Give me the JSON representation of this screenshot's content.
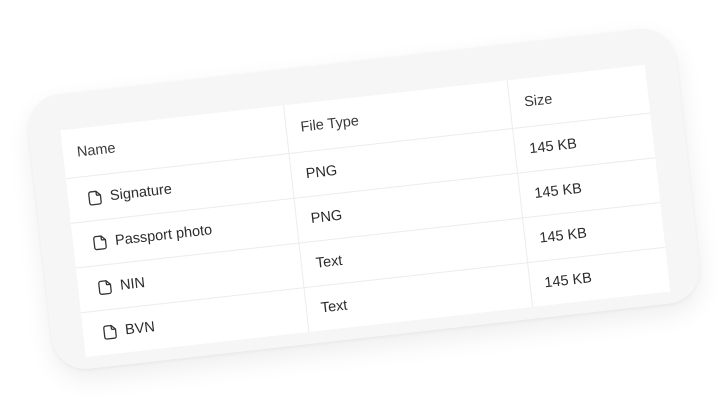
{
  "table": {
    "headers": {
      "name": "Name",
      "file_type": "File Type",
      "size": "Size"
    },
    "rows": [
      {
        "icon": "file-icon",
        "name": "Signature",
        "file_type": "PNG",
        "size": "145 KB"
      },
      {
        "icon": "file-icon",
        "name": "Passport photo",
        "file_type": "PNG",
        "size": "145 KB"
      },
      {
        "icon": "file-icon",
        "name": "NIN",
        "file_type": "Text",
        "size": "145 KB"
      },
      {
        "icon": "file-icon",
        "name": "BVN",
        "file_type": "Text",
        "size": "145 KB"
      }
    ]
  },
  "colors": {
    "card_background": "#f6f6f6",
    "table_background": "#ffffff",
    "border": "#ececec",
    "text": "#2b2b2b"
  }
}
